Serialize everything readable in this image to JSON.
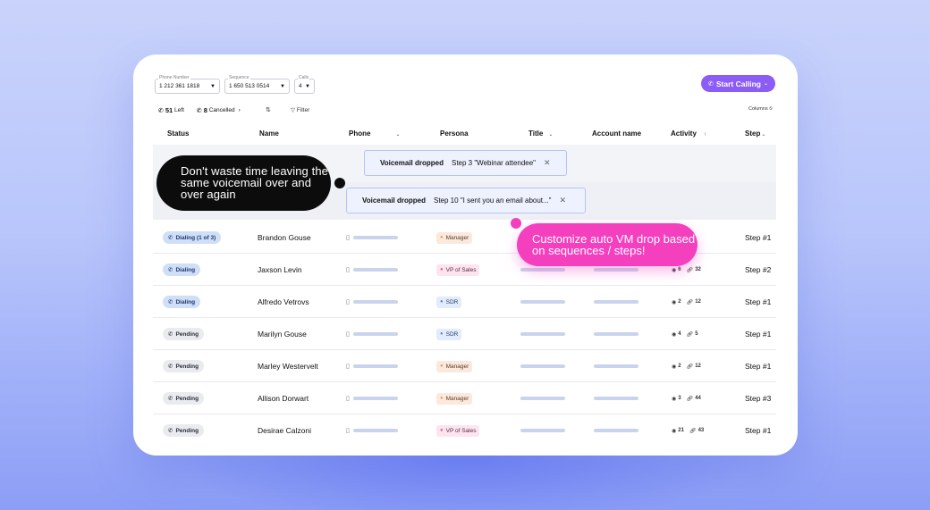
{
  "filters": {
    "phone_number": {
      "label": "Phone Number",
      "value": "1 212 361 1818"
    },
    "sequence": {
      "label": "Sequence",
      "value": "1 650 513 0514"
    },
    "calls": {
      "label": "Calls",
      "value": "4"
    }
  },
  "start_calling_label": "Start Calling",
  "stats": {
    "left_count": "51",
    "left_label": "Left",
    "cancelled_count": "8",
    "cancelled_label": "Cancelled",
    "filter_label": "Filter",
    "columns_label": "Columns"
  },
  "table": {
    "headers": {
      "status": "Status",
      "name": "Name",
      "phone": "Phone",
      "persona": "Persona",
      "title": "Title",
      "account": "Account name",
      "activity": "Activity",
      "step": "Step"
    },
    "rows": [
      {
        "status": "Dialing (1 of 3)",
        "status_type": "dialing",
        "name": "Brandon Gouse",
        "persona": "Manager",
        "persona_type": "manager",
        "views": "",
        "links": "",
        "step": "Step #1"
      },
      {
        "status": "Dialing",
        "status_type": "dialing",
        "name": "Jaxson Levin",
        "persona": "VP of Sales",
        "persona_type": "vp",
        "views": "6",
        "links": "32",
        "step": "Step #2"
      },
      {
        "status": "Dialing",
        "status_type": "dialing",
        "name": "Alfredo Vetrovs",
        "persona": "SDR",
        "persona_type": "sdr",
        "views": "2",
        "links": "12",
        "step": "Step #1"
      },
      {
        "status": "Pending",
        "status_type": "pending",
        "name": "Marilyn Gouse",
        "persona": "SDR",
        "persona_type": "sdr",
        "views": "4",
        "links": "5",
        "step": "Step #1"
      },
      {
        "status": "Pending",
        "status_type": "pending",
        "name": "Marley Westervelt",
        "persona": "Manager",
        "persona_type": "manager",
        "views": "2",
        "links": "12",
        "step": "Step #1"
      },
      {
        "status": "Pending",
        "status_type": "pending",
        "name": "Allison Dorwart",
        "persona": "Manager",
        "persona_type": "manager",
        "views": "3",
        "links": "44",
        "step": "Step #3"
      },
      {
        "status": "Pending",
        "status_type": "pending",
        "name": "Desirae Calzoni",
        "persona": "VP of Sales",
        "persona_type": "vp",
        "views": "21",
        "links": "43",
        "step": "Step #1"
      }
    ]
  },
  "voicemail_banners": [
    {
      "label": "Voicemail dropped",
      "detail": "Step 3 \"Webinar attendee\""
    },
    {
      "label": "Voicemail dropped",
      "detail": "Step 10 \"I sent you an email about...\""
    }
  ],
  "callouts": {
    "black": "Don't waste time leaving the same voicemail over and over again",
    "pink": "Customize auto VM drop based on sequences / steps!"
  },
  "colors": {
    "accent_purple": "#8b5cf6",
    "callout_pink": "#f43fbe",
    "callout_black": "#0c0c0c"
  }
}
